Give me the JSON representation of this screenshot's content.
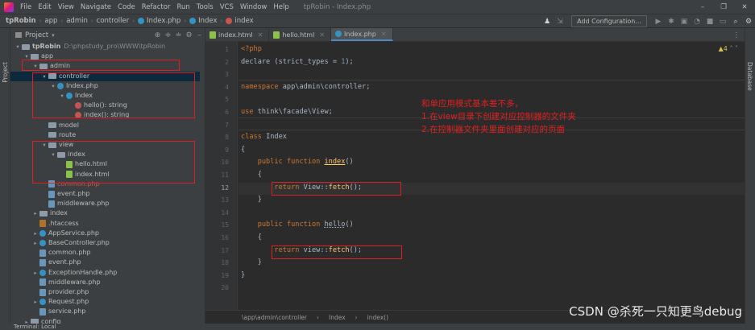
{
  "menubar": {
    "items": [
      "File",
      "Edit",
      "View",
      "Navigate",
      "Code",
      "Refactor",
      "Run",
      "Tools",
      "VCS",
      "Window",
      "Help"
    ],
    "window_title": "tpRobin - Index.php"
  },
  "breadcrumb": {
    "items": [
      "tpRobin",
      "app",
      "admin",
      "controller",
      "Index.php",
      "Index",
      "index"
    ]
  },
  "toolbar": {
    "add_configuration": "Add Configuration..."
  },
  "project_panel": {
    "title": "Project",
    "side_label": "Project"
  },
  "tree": [
    {
      "label": "tpRobin",
      "hint": "D:\\phpstudy_pro\\WWW\\tpRobin",
      "level": 0,
      "icon": "folder",
      "arrow": "down",
      "bold": true
    },
    {
      "label": "app",
      "level": 1,
      "icon": "folder",
      "arrow": "down"
    },
    {
      "label": "admin",
      "level": 2,
      "icon": "folder",
      "arrow": "down"
    },
    {
      "label": "controller",
      "level": 3,
      "icon": "folder",
      "arrow": "down",
      "selected": true
    },
    {
      "label": "Index.php",
      "level": 4,
      "icon": "php-class",
      "arrow": "down"
    },
    {
      "label": "Index",
      "level": 5,
      "icon": "class",
      "arrow": "down"
    },
    {
      "label": "hello(): string",
      "level": 6,
      "icon": "method"
    },
    {
      "label": "index(): string",
      "level": 6,
      "icon": "method"
    },
    {
      "label": "model",
      "level": 3,
      "icon": "folder"
    },
    {
      "label": "route",
      "level": 3,
      "icon": "folder"
    },
    {
      "label": "view",
      "level": 3,
      "icon": "folder",
      "arrow": "down"
    },
    {
      "label": "index",
      "level": 4,
      "icon": "folder",
      "arrow": "down"
    },
    {
      "label": "hello.html",
      "level": 5,
      "icon": "html"
    },
    {
      "label": "index.html",
      "level": 5,
      "icon": "html"
    },
    {
      "label": "common.php",
      "level": 3,
      "icon": "php",
      "red": true
    },
    {
      "label": "event.php",
      "level": 3,
      "icon": "php"
    },
    {
      "label": "middleware.php",
      "level": 3,
      "icon": "php"
    },
    {
      "label": "index",
      "level": 2,
      "icon": "folder",
      "arrow": "right"
    },
    {
      "label": ".htaccess",
      "level": 2,
      "icon": "htaccess"
    },
    {
      "label": "AppService.php",
      "level": 2,
      "icon": "php-class",
      "arrow": "right"
    },
    {
      "label": "BaseController.php",
      "level": 2,
      "icon": "php-class",
      "arrow": "right"
    },
    {
      "label": "common.php",
      "level": 2,
      "icon": "php"
    },
    {
      "label": "event.php",
      "level": 2,
      "icon": "php"
    },
    {
      "label": "ExceptionHandle.php",
      "level": 2,
      "icon": "php-class",
      "arrow": "right"
    },
    {
      "label": "middleware.php",
      "level": 2,
      "icon": "php"
    },
    {
      "label": "provider.php",
      "level": 2,
      "icon": "php"
    },
    {
      "label": "Request.php",
      "level": 2,
      "icon": "php-class",
      "arrow": "right"
    },
    {
      "label": "service.php",
      "level": 2,
      "icon": "php"
    },
    {
      "label": "config",
      "level": 1,
      "icon": "folder",
      "arrow": "right"
    }
  ],
  "tabs": [
    {
      "label": "index.html"
    },
    {
      "label": "hello.html"
    },
    {
      "label": "Index.php",
      "active": true
    }
  ],
  "editor": {
    "warning": "▲4",
    "line_numbers": [
      "1",
      "2",
      "3",
      "4",
      "5",
      "6",
      "7",
      "8",
      "9",
      "10",
      "11",
      "12",
      "13",
      "14",
      "15",
      "16",
      "17",
      "18",
      "19",
      "20"
    ],
    "current_line": 12,
    "annotation": [
      "和单应用模式基本差不多，",
      "1.在view目录下创建对应控制器的文件夹",
      "2.在控制器文件夹里面创建对应的页面"
    ]
  },
  "statusbar": {
    "path": [
      "\\app\\admin\\controller",
      "Index",
      "index()"
    ]
  },
  "bottombar": {
    "label": "Terminal:  Local"
  },
  "watermark": "CSDN @杀死一只知更鸟debug",
  "right_strip": {
    "label": "Database"
  }
}
